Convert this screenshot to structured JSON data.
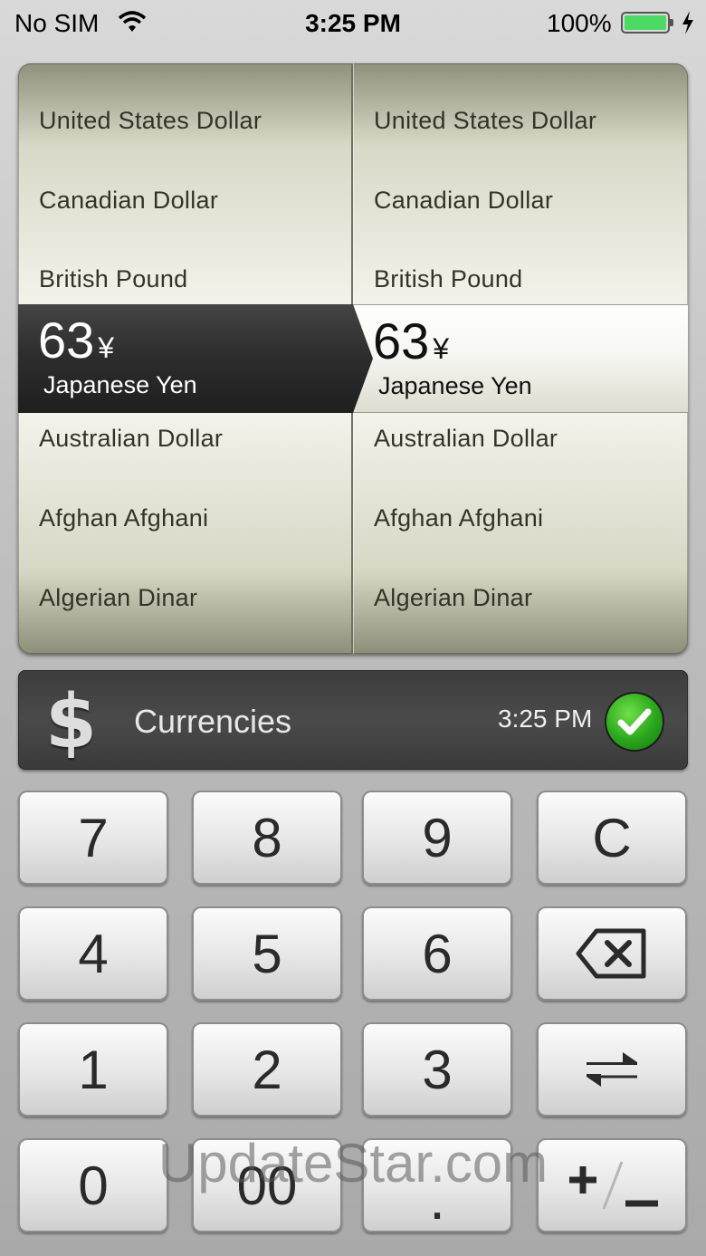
{
  "status_bar": {
    "carrier": "No SIM",
    "time": "3:25 PM",
    "battery_percent": "100%",
    "battery_color": "#4cd964"
  },
  "picker": {
    "left": {
      "items_above": [
        "United States Dollar",
        "Canadian Dollar",
        "British Pound"
      ],
      "selected": {
        "amount": "63",
        "symbol": "¥",
        "name": "Japanese Yen"
      },
      "items_below": [
        "Australian Dollar",
        "Afghan Afghani",
        "Algerian Dinar"
      ]
    },
    "right": {
      "items_above": [
        "United States Dollar",
        "Canadian Dollar",
        "British Pound"
      ],
      "selected": {
        "amount": "63",
        "symbol": "¥",
        "name": "Japanese Yen"
      },
      "items_below": [
        "Australian Dollar",
        "Afghan Afghani",
        "Algerian Dinar"
      ]
    }
  },
  "info_bar": {
    "icon": "dollar-icon",
    "icon_glyph": "$",
    "title": "Currencies",
    "updated_time": "3:25 PM",
    "status_icon": "check-icon",
    "status_color": "#2aa51c"
  },
  "keypad": {
    "seven": "7",
    "eight": "8",
    "nine": "9",
    "clear": "C",
    "four": "4",
    "five": "5",
    "six": "6",
    "backspace_icon": "backspace-icon",
    "one": "1",
    "two": "2",
    "three": "3",
    "swap_icon": "swap-icon",
    "zero": "0",
    "double_zero": "00",
    "decimal": ".",
    "sign_icon": "plus-minus-icon"
  },
  "watermark": "UpdateStar.com"
}
